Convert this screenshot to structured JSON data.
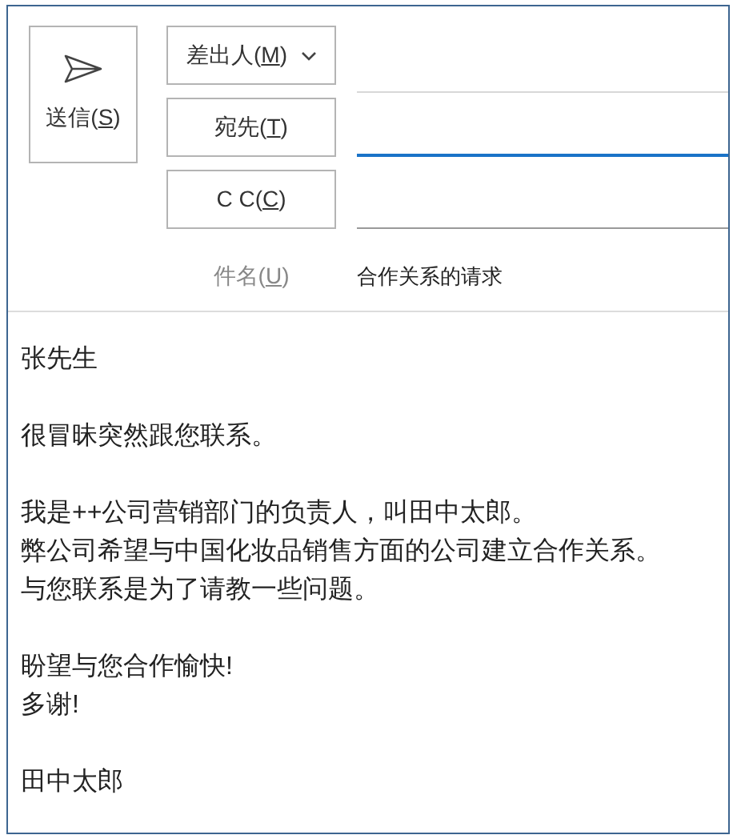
{
  "send_button": {
    "label_before": "送信(",
    "access_key": "S",
    "label_after": ")"
  },
  "address_rows": [
    {
      "kind": "dropdown",
      "label_before": "差出人(",
      "access_key": "M",
      "label_after": ")"
    },
    {
      "kind": "button",
      "label_before": "宛先(",
      "access_key": "T",
      "label_after": ")",
      "focused": true
    },
    {
      "kind": "button",
      "label_before": "C C(",
      "access_key": "C",
      "label_after": ")",
      "focused": false
    }
  ],
  "subject": {
    "label_before": "件名(",
    "access_key": "U",
    "label_after": ")",
    "value": "合作关系的请求"
  },
  "body": [
    [
      "张先生"
    ],
    [
      "很冒昧突然跟您联系。"
    ],
    [
      "我是++公司营销部门的负责人，叫田中太郎。",
      "弊公司希望与中国化妆品销售方面的公司建立合作关系。",
      "与您联系是为了请教一些问题。"
    ],
    [
      "盼望与您合作愉快!",
      "多谢!"
    ],
    [
      "田中太郎"
    ]
  ]
}
